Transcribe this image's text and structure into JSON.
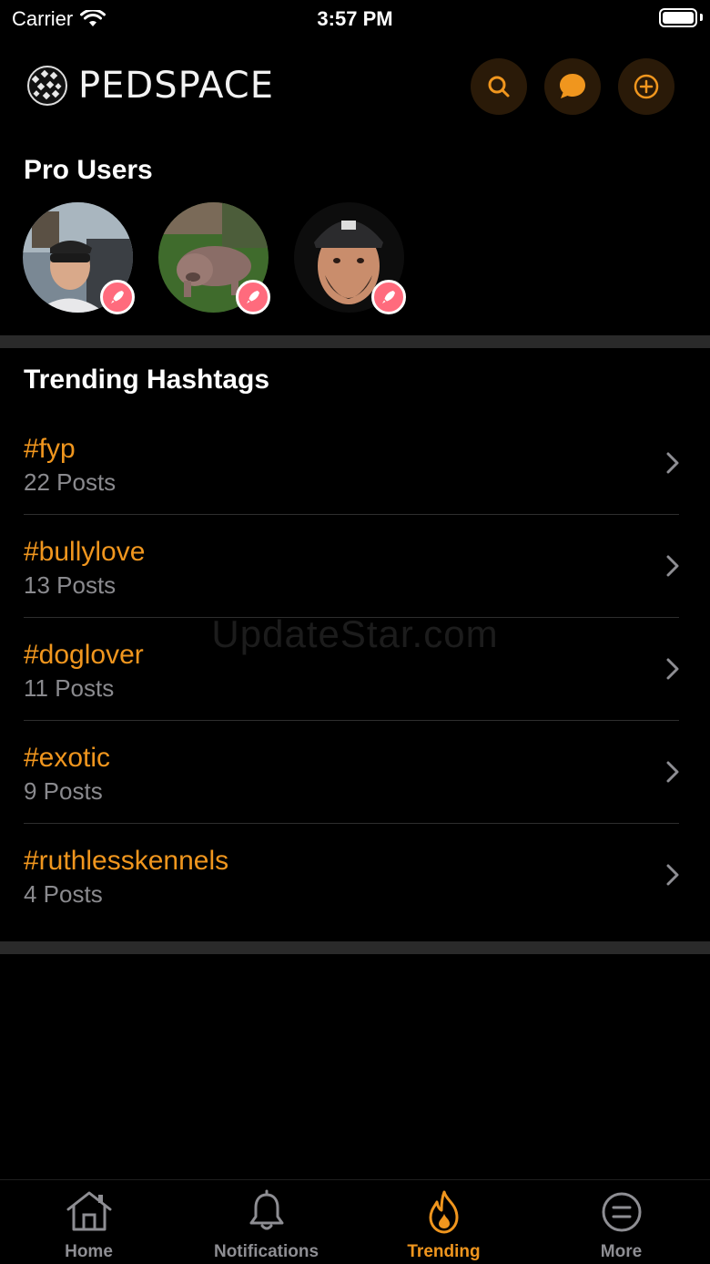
{
  "status_bar": {
    "carrier": "Carrier",
    "time": "3:57 PM"
  },
  "header": {
    "logo_text": "PEDSPACE",
    "buttons": [
      {
        "icon": "search-icon"
      },
      {
        "icon": "chat-bubble-icon"
      },
      {
        "icon": "plus-circle-icon"
      }
    ]
  },
  "pro_users": {
    "title": "Pro Users",
    "users": [
      {
        "avatar": "man-sunglasses-photo",
        "badge_icon": "rocket-icon"
      },
      {
        "avatar": "bully-dog-photo",
        "badge_icon": "rocket-icon"
      },
      {
        "avatar": "man-cap-photo",
        "badge_icon": "rocket-icon"
      }
    ]
  },
  "trending": {
    "title": "Trending Hashtags",
    "items": [
      {
        "tag": "#fyp",
        "count": "22 Posts"
      },
      {
        "tag": "#bullylove",
        "count": "13 Posts"
      },
      {
        "tag": "#doglover",
        "count": "11 Posts"
      },
      {
        "tag": "#exotic",
        "count": "9 Posts"
      },
      {
        "tag": "#ruthlesskennels",
        "count": "4 Posts"
      }
    ]
  },
  "watermark": "UpdateStar.com",
  "tab_bar": {
    "tabs": [
      {
        "label": "Home",
        "icon": "home-icon",
        "active": false
      },
      {
        "label": "Notifications",
        "icon": "bell-icon",
        "active": false
      },
      {
        "label": "Trending",
        "icon": "flame-icon",
        "active": true
      },
      {
        "label": "More",
        "icon": "more-circle-icon",
        "active": false
      }
    ]
  },
  "colors": {
    "accent": "#f0961e",
    "background": "#000000",
    "badge": "#ff6b7d",
    "secondary_text": "#8a8a8e"
  }
}
